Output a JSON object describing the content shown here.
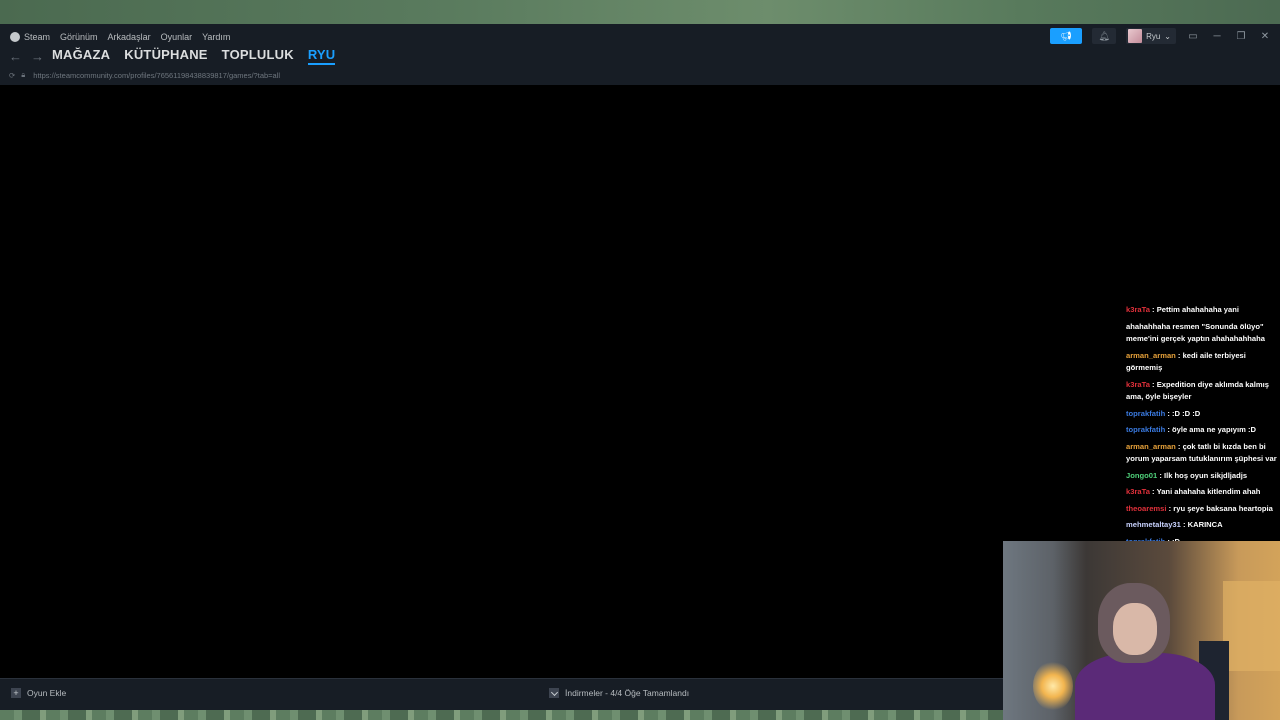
{
  "menu": {
    "items": [
      "Steam",
      "Görünüm",
      "Arkadaşlar",
      "Oyunlar",
      "Yardım"
    ]
  },
  "nav": {
    "items": [
      {
        "label": "MAĞAZA",
        "active": false
      },
      {
        "label": "KÜTÜPHANE",
        "active": false
      },
      {
        "label": "TOPLULUK",
        "active": false
      },
      {
        "label": "RYU",
        "active": true
      }
    ]
  },
  "history": {
    "back": "←",
    "forward": "→"
  },
  "urlbar": {
    "url": "https://steamcommunity.com/profiles/76561198438839817/games/?tab=all",
    "lock_icon": "lock-icon",
    "reload_icon": "reload-icon"
  },
  "topright": {
    "announce_icon": "megaphone-icon",
    "bell_icon": "bell-icon",
    "username": "Ryu",
    "big_picture_icon": "monitor-icon"
  },
  "window_controls": {
    "minimize": "─",
    "restore": "❐",
    "close": "✕"
  },
  "bottombar": {
    "add_game": "Oyun Ekle",
    "downloads": "İndirmeler - 4/4 Öğe Tamamlandı"
  },
  "chat": {
    "lines": [
      {
        "user": "k3raTa",
        "color": "#e0303a",
        "text": "Pettim ahahahaha yani"
      },
      {
        "user": "",
        "color": "#ffffff",
        "text": "ahahahhaha resmen \"Sonunda ölüyo\" meme'ini gerçek yaptın ahahahahhaha"
      },
      {
        "user": "arman_arman",
        "color": "#e8a23a",
        "text": "kedi aile terbiyesi görmemiş"
      },
      {
        "user": "k3raTa",
        "color": "#e0303a",
        "text": "Expedition diye aklımda kalmış ama, öyle bişeyler"
      },
      {
        "user": "toprakfatih",
        "color": "#3a7ae0",
        "text": ":D :D :D"
      },
      {
        "user": "toprakfatih",
        "color": "#3a7ae0",
        "text": "öyle ama ne yapıyım :D"
      },
      {
        "user": "arman_arman",
        "color": "#e8a23a",
        "text": "çok tatlı bi kızda ben bi yorum yaparsam tutuklanırım şüphesi var"
      },
      {
        "user": "Jongo01",
        "color": "#4fd17a",
        "text": "Ilk hoş oyun sikjdljadjs"
      },
      {
        "user": "k3raTa",
        "color": "#e0303a",
        "text": "Yani ahahaha kitlendim ahah"
      },
      {
        "user": "theoaremsi",
        "color": "#e0303a",
        "text": "ryu şeye baksana heartopia"
      },
      {
        "user": "mehmetaltay31",
        "color": "#c9d3ff",
        "text": "KARINCA"
      },
      {
        "user": "toprakfatih",
        "color": "#3a7ae0",
        "text": ":D"
      }
    ]
  },
  "webcam": {
    "label": "streamer-webcam"
  }
}
